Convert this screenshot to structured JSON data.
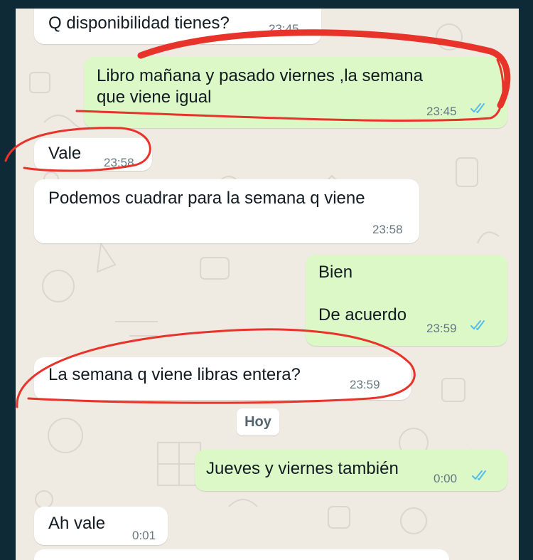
{
  "messages": [
    {
      "text": "Q disponibilidad tienes?",
      "time": "23:45",
      "direction": "in"
    },
    {
      "text": "Libro mañana y pasado viernes ,la semana\nque viene igual",
      "time": "23:45",
      "direction": "out",
      "status": "read"
    },
    {
      "text": "Vale",
      "time": "23:58",
      "direction": "in"
    },
    {
      "text": "Podemos cuadrar para la semana q viene",
      "time": "23:58",
      "direction": "in"
    },
    {
      "text": "Bien\n\nDe acuerdo",
      "time": "23:59",
      "direction": "out",
      "status": "read"
    },
    {
      "text": "La semana q viene libras entera?",
      "time": "23:59",
      "direction": "in"
    },
    {
      "text": "Jueves y viernes también",
      "time": "0:00",
      "direction": "out",
      "status": "read"
    },
    {
      "text": "Ah vale",
      "time": "0:01",
      "direction": "in"
    }
  ],
  "date_divider": "Hoy",
  "colors": {
    "incoming_bubble": "#ffffff",
    "outgoing_bubble": "#dcf8c6",
    "read_ticks": "#53bdeb",
    "annotation_marker": "#e8332a",
    "chat_background": "#efeae2"
  }
}
